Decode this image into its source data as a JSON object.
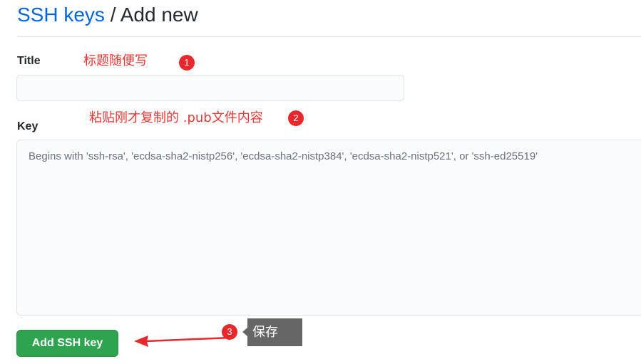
{
  "header": {
    "breadcrumb_link": "SSH keys",
    "separator": "/",
    "current": "Add new"
  },
  "form": {
    "title_label": "Title",
    "title_value": "",
    "key_label": "Key",
    "key_placeholder": "Begins with 'ssh-rsa', 'ecdsa-sha2-nistp256', 'ecdsa-sha2-nistp384', 'ecdsa-sha2-nistp521', or 'ssh-ed25519'",
    "submit_label": "Add SSH key"
  },
  "annotations": {
    "title_note": "标题随便写",
    "key_note": "粘贴刚才复制的 .pub文件内容",
    "save_note": "保存",
    "step1": "1",
    "step2": "2",
    "step3": "3"
  },
  "colors": {
    "link": "#0366d6",
    "primary_button": "#2ea44f",
    "annotation": "#e53935",
    "tooltip_bg": "#666666"
  },
  "icons": {
    "arrow": "left-arrow-icon"
  }
}
